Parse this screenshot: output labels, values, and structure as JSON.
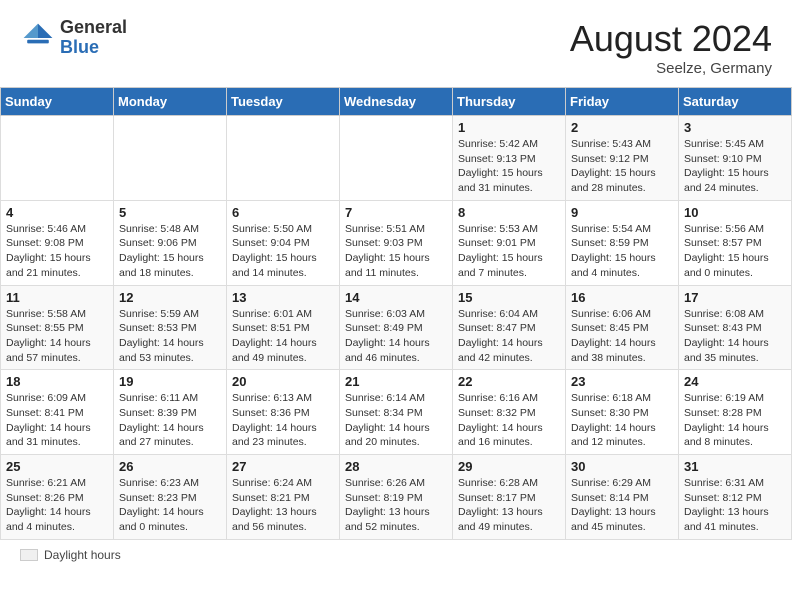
{
  "header": {
    "logo_general": "General",
    "logo_blue": "Blue",
    "month_title": "August 2024",
    "location": "Seelze, Germany"
  },
  "legend": {
    "label": "Daylight hours"
  },
  "calendar": {
    "headers": [
      "Sunday",
      "Monday",
      "Tuesday",
      "Wednesday",
      "Thursday",
      "Friday",
      "Saturday"
    ],
    "weeks": [
      [
        {
          "day": "",
          "info": ""
        },
        {
          "day": "",
          "info": ""
        },
        {
          "day": "",
          "info": ""
        },
        {
          "day": "",
          "info": ""
        },
        {
          "day": "1",
          "info": "Sunrise: 5:42 AM\nSunset: 9:13 PM\nDaylight: 15 hours\nand 31 minutes."
        },
        {
          "day": "2",
          "info": "Sunrise: 5:43 AM\nSunset: 9:12 PM\nDaylight: 15 hours\nand 28 minutes."
        },
        {
          "day": "3",
          "info": "Sunrise: 5:45 AM\nSunset: 9:10 PM\nDaylight: 15 hours\nand 24 minutes."
        }
      ],
      [
        {
          "day": "4",
          "info": "Sunrise: 5:46 AM\nSunset: 9:08 PM\nDaylight: 15 hours\nand 21 minutes."
        },
        {
          "day": "5",
          "info": "Sunrise: 5:48 AM\nSunset: 9:06 PM\nDaylight: 15 hours\nand 18 minutes."
        },
        {
          "day": "6",
          "info": "Sunrise: 5:50 AM\nSunset: 9:04 PM\nDaylight: 15 hours\nand 14 minutes."
        },
        {
          "day": "7",
          "info": "Sunrise: 5:51 AM\nSunset: 9:03 PM\nDaylight: 15 hours\nand 11 minutes."
        },
        {
          "day": "8",
          "info": "Sunrise: 5:53 AM\nSunset: 9:01 PM\nDaylight: 15 hours\nand 7 minutes."
        },
        {
          "day": "9",
          "info": "Sunrise: 5:54 AM\nSunset: 8:59 PM\nDaylight: 15 hours\nand 4 minutes."
        },
        {
          "day": "10",
          "info": "Sunrise: 5:56 AM\nSunset: 8:57 PM\nDaylight: 15 hours\nand 0 minutes."
        }
      ],
      [
        {
          "day": "11",
          "info": "Sunrise: 5:58 AM\nSunset: 8:55 PM\nDaylight: 14 hours\nand 57 minutes."
        },
        {
          "day": "12",
          "info": "Sunrise: 5:59 AM\nSunset: 8:53 PM\nDaylight: 14 hours\nand 53 minutes."
        },
        {
          "day": "13",
          "info": "Sunrise: 6:01 AM\nSunset: 8:51 PM\nDaylight: 14 hours\nand 49 minutes."
        },
        {
          "day": "14",
          "info": "Sunrise: 6:03 AM\nSunset: 8:49 PM\nDaylight: 14 hours\nand 46 minutes."
        },
        {
          "day": "15",
          "info": "Sunrise: 6:04 AM\nSunset: 8:47 PM\nDaylight: 14 hours\nand 42 minutes."
        },
        {
          "day": "16",
          "info": "Sunrise: 6:06 AM\nSunset: 8:45 PM\nDaylight: 14 hours\nand 38 minutes."
        },
        {
          "day": "17",
          "info": "Sunrise: 6:08 AM\nSunset: 8:43 PM\nDaylight: 14 hours\nand 35 minutes."
        }
      ],
      [
        {
          "day": "18",
          "info": "Sunrise: 6:09 AM\nSunset: 8:41 PM\nDaylight: 14 hours\nand 31 minutes."
        },
        {
          "day": "19",
          "info": "Sunrise: 6:11 AM\nSunset: 8:39 PM\nDaylight: 14 hours\nand 27 minutes."
        },
        {
          "day": "20",
          "info": "Sunrise: 6:13 AM\nSunset: 8:36 PM\nDaylight: 14 hours\nand 23 minutes."
        },
        {
          "day": "21",
          "info": "Sunrise: 6:14 AM\nSunset: 8:34 PM\nDaylight: 14 hours\nand 20 minutes."
        },
        {
          "day": "22",
          "info": "Sunrise: 6:16 AM\nSunset: 8:32 PM\nDaylight: 14 hours\nand 16 minutes."
        },
        {
          "day": "23",
          "info": "Sunrise: 6:18 AM\nSunset: 8:30 PM\nDaylight: 14 hours\nand 12 minutes."
        },
        {
          "day": "24",
          "info": "Sunrise: 6:19 AM\nSunset: 8:28 PM\nDaylight: 14 hours\nand 8 minutes."
        }
      ],
      [
        {
          "day": "25",
          "info": "Sunrise: 6:21 AM\nSunset: 8:26 PM\nDaylight: 14 hours\nand 4 minutes."
        },
        {
          "day": "26",
          "info": "Sunrise: 6:23 AM\nSunset: 8:23 PM\nDaylight: 14 hours\nand 0 minutes."
        },
        {
          "day": "27",
          "info": "Sunrise: 6:24 AM\nSunset: 8:21 PM\nDaylight: 13 hours\nand 56 minutes."
        },
        {
          "day": "28",
          "info": "Sunrise: 6:26 AM\nSunset: 8:19 PM\nDaylight: 13 hours\nand 52 minutes."
        },
        {
          "day": "29",
          "info": "Sunrise: 6:28 AM\nSunset: 8:17 PM\nDaylight: 13 hours\nand 49 minutes."
        },
        {
          "day": "30",
          "info": "Sunrise: 6:29 AM\nSunset: 8:14 PM\nDaylight: 13 hours\nand 45 minutes."
        },
        {
          "day": "31",
          "info": "Sunrise: 6:31 AM\nSunset: 8:12 PM\nDaylight: 13 hours\nand 41 minutes."
        }
      ]
    ]
  }
}
